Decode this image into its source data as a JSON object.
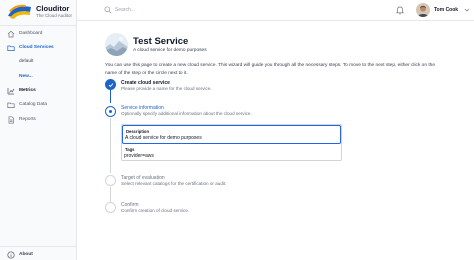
{
  "app": {
    "name": "Clouditor",
    "subtitle": "The Cloud Auditor"
  },
  "sidebar": {
    "items": [
      {
        "label": "Dashboard",
        "icon": "home-icon"
      },
      {
        "label": "Cloud Services",
        "icon": "cloud-icon"
      },
      {
        "label": "Metrics",
        "icon": "chart-icon"
      },
      {
        "label": "Catalog Data",
        "icon": "folder-icon"
      },
      {
        "label": "Reports",
        "icon": "document-icon"
      }
    ],
    "sub_items": [
      {
        "label": "default"
      },
      {
        "label": "New..."
      }
    ],
    "about": "About"
  },
  "topbar": {
    "search_placeholder": "Search...",
    "user_name": "Tom Cook"
  },
  "service": {
    "title": "Test Service",
    "subtitle": "A cloud service for demo purposes"
  },
  "intro": "You can use this page to create a new cloud service. This wizard will guide you through all the necessary steps. To move to the next step, either click on the name of the step or the circle next to it.",
  "steps": [
    {
      "title": "Create cloud service",
      "desc": "Please provide a name for the cloud service."
    },
    {
      "title": "Service information",
      "desc": "Optionally specify additional information about the cloud service."
    },
    {
      "title": "Target of evaluation",
      "desc": "Select relevant catalogs for the certification or audit."
    },
    {
      "title": "Confirm",
      "desc": "Confirm creation of cloud service."
    }
  ],
  "form": {
    "description_label": "Description",
    "description_value": "A cloud service for demo purposes",
    "tags_label": "Tags",
    "tags_value": "provider=aws"
  },
  "colors": {
    "accent": "#1d64c8",
    "sidebar_bg": "#f9fafb",
    "border": "#e5e7eb"
  }
}
